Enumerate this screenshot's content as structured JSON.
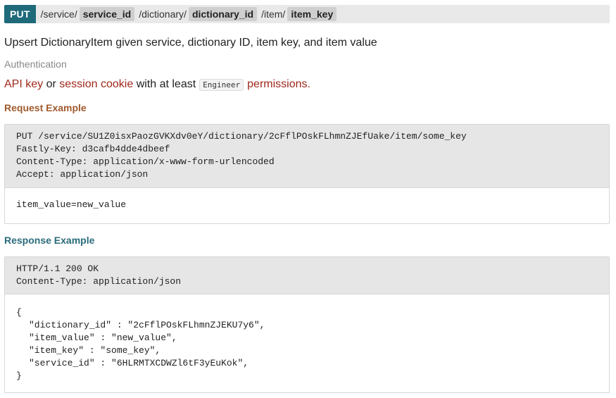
{
  "endpoint": {
    "method": "PUT",
    "segments": [
      "/service/",
      "service_id",
      "/dictionary/",
      "dictionary_id",
      "/item/",
      "item_key"
    ]
  },
  "summary": "Upsert DictionaryItem given service, dictionary ID, item key, and item value",
  "auth": {
    "label": "Authentication",
    "api_key": "API key",
    "or": "or",
    "session_cookie": "session cookie",
    "with_at_least": "with at least",
    "role": "Engineer",
    "permissions": "permissions."
  },
  "request": {
    "heading": "Request Example",
    "head_lines": [
      "PUT /service/SU1Z0isxPaozGVKXdv0eY/dictionary/2cFflPOskFLhmnZJEfUake/item/some_key",
      "Fastly-Key: d3cafb4dde4dbeef",
      "Content-Type: application/x-www-form-urlencoded",
      "Accept: application/json"
    ],
    "body": "item_value=new_value"
  },
  "response": {
    "heading": "Response Example",
    "head_lines": [
      "HTTP/1.1 200 OK",
      "Content-Type: application/json"
    ],
    "body_open": "{",
    "body_lines": [
      "\"dictionary_id\" : \"2cFflPOskFLhmnZJEKU7y6\",",
      "\"item_value\" : \"new_value\",",
      "\"item_key\" : \"some_key\",",
      "\"service_id\" : \"6HLRMTXCDWZl6tF3yEuKok\","
    ],
    "body_close": "}"
  },
  "colors": {
    "method_bg": "#1e6a7b",
    "link": "#a0281c",
    "request_heading": "#a05a2c",
    "response_heading": "#2b6b7b"
  }
}
